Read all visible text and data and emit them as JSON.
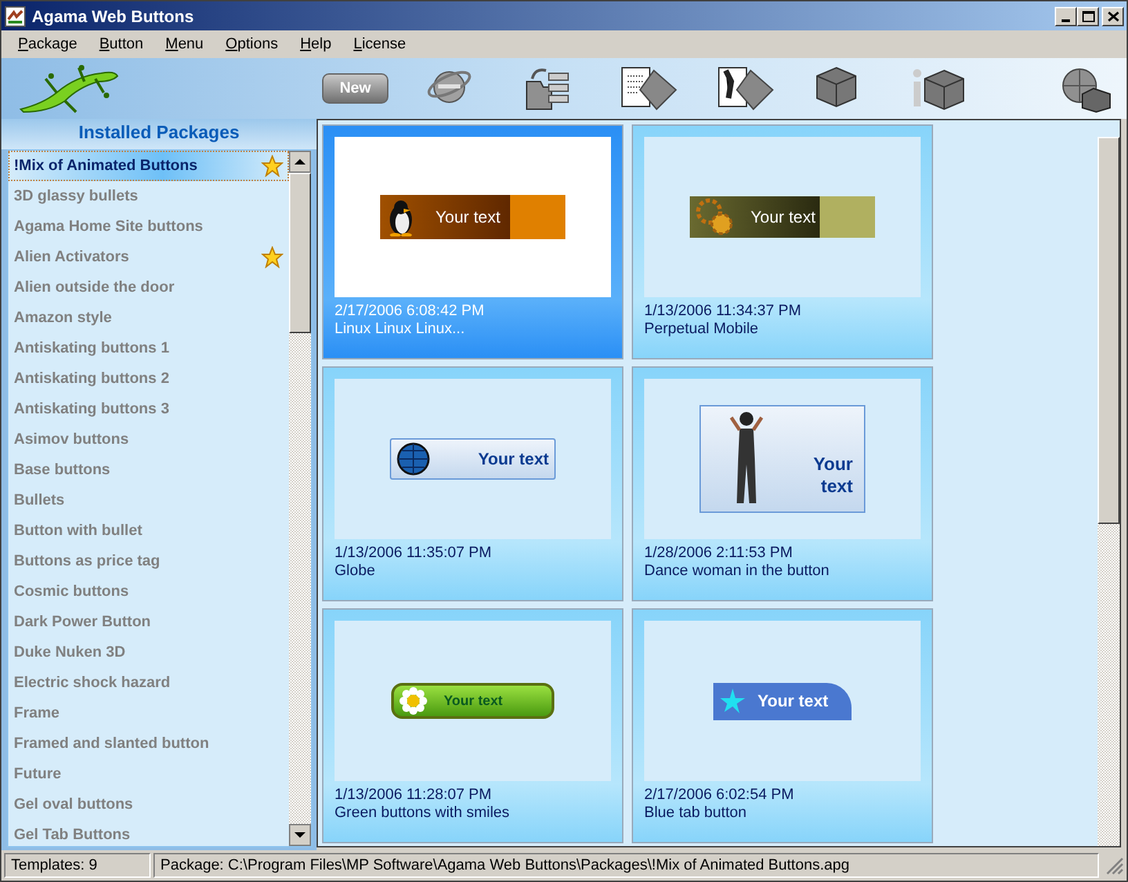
{
  "window": {
    "title": "Agama Web Buttons"
  },
  "menu": [
    "Package",
    "Button",
    "Menu",
    "Options",
    "Help",
    "License"
  ],
  "toolbar": {
    "new_button": "New"
  },
  "sidebar": {
    "title": "Installed Packages",
    "items": [
      {
        "label": "!Mix of Animated Buttons",
        "selected": true,
        "favorite": true
      },
      {
        "label": "3D glassy bullets",
        "selected": false,
        "favorite": false
      },
      {
        "label": "Agama Home Site buttons",
        "selected": false,
        "favorite": false
      },
      {
        "label": "Alien Activators",
        "selected": false,
        "favorite": true
      },
      {
        "label": "Alien outside the door",
        "selected": false,
        "favorite": false
      },
      {
        "label": "Amazon style",
        "selected": false,
        "favorite": false
      },
      {
        "label": "Antiskating buttons 1",
        "selected": false,
        "favorite": false
      },
      {
        "label": "Antiskating buttons 2",
        "selected": false,
        "favorite": false
      },
      {
        "label": "Antiskating buttons 3",
        "selected": false,
        "favorite": false
      },
      {
        "label": "Asimov buttons",
        "selected": false,
        "favorite": false
      },
      {
        "label": "Base buttons",
        "selected": false,
        "favorite": false
      },
      {
        "label": "Bullets",
        "selected": false,
        "favorite": false
      },
      {
        "label": "Button with bullet",
        "selected": false,
        "favorite": false
      },
      {
        "label": "Buttons as price tag",
        "selected": false,
        "favorite": false
      },
      {
        "label": "Cosmic buttons",
        "selected": false,
        "favorite": false
      },
      {
        "label": "Dark Power Button",
        "selected": false,
        "favorite": false
      },
      {
        "label": "Duke Nuken 3D",
        "selected": false,
        "favorite": false
      },
      {
        "label": "Electric shock hazard",
        "selected": false,
        "favorite": false
      },
      {
        "label": "Frame",
        "selected": false,
        "favorite": false
      },
      {
        "label": "Framed and slanted button",
        "selected": false,
        "favorite": false
      },
      {
        "label": "Future",
        "selected": false,
        "favorite": false
      },
      {
        "label": "Gel oval buttons",
        "selected": false,
        "favorite": false
      },
      {
        "label": "Gel Tab Buttons",
        "selected": false,
        "favorite": false
      }
    ]
  },
  "templates": [
    {
      "date": "2/17/2006 6:08:42 PM",
      "name": "Linux Linux Linux...",
      "selected": true,
      "preview": {
        "kind": "penguin",
        "label": "Your text"
      }
    },
    {
      "date": "1/13/2006 11:34:37 PM",
      "name": "Perpetual Mobile",
      "selected": false,
      "preview": {
        "kind": "gears",
        "label": "Your text"
      }
    },
    {
      "date": "1/13/2006 11:35:07 PM",
      "name": "Globe",
      "selected": false,
      "preview": {
        "kind": "globe",
        "label": "Your text"
      }
    },
    {
      "date": "1/28/2006 2:11:53 PM",
      "name": "Dance woman in the button",
      "selected": false,
      "preview": {
        "kind": "dancer",
        "label": "Your text"
      }
    },
    {
      "date": "1/13/2006 11:28:07 PM",
      "name": "Green buttons with smiles",
      "selected": false,
      "preview": {
        "kind": "flower",
        "label": "Your text"
      }
    },
    {
      "date": "2/17/2006 6:02:54 PM",
      "name": "Blue tab button",
      "selected": false,
      "preview": {
        "kind": "star",
        "label": "Your text"
      }
    }
  ],
  "status_bar": {
    "count": "Templates: 9",
    "path": "Package: C:\\Program Files\\MP Software\\Agama Web Buttons\\Packages\\!Mix of Animated Buttons.apg"
  }
}
